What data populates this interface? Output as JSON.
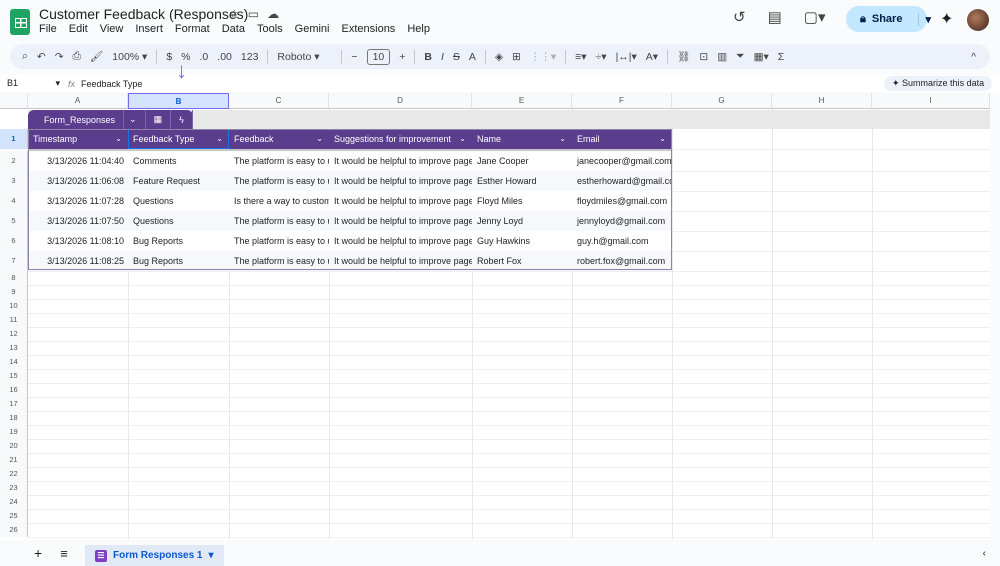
{
  "app": {
    "title": "Customer Feedback (Responses)",
    "menu": [
      "File",
      "Edit",
      "View",
      "Insert",
      "Format",
      "Data",
      "Tools",
      "Gemini",
      "Extensions",
      "Help"
    ],
    "share_label": "Share"
  },
  "toolbar": {
    "zoom": "100%",
    "currency": "$",
    "percent": "%",
    "dec_decrease": ".0",
    "dec_increase": ".00",
    "format": "123",
    "font": "Roboto",
    "font_size": "10",
    "bold": "B",
    "italic": "I"
  },
  "formula_bar": {
    "cell_ref": "B1",
    "fx": "fx",
    "value": "Feedback Type"
  },
  "summarize_label": "Summarize this data",
  "columns": [
    "A",
    "B",
    "C",
    "D",
    "E",
    "F",
    "G",
    "H",
    "I"
  ],
  "rows": [
    "1",
    "2",
    "3",
    "4",
    "5",
    "6",
    "7",
    "8",
    "9",
    "10",
    "11",
    "12",
    "13",
    "14",
    "15",
    "16",
    "17",
    "18",
    "19",
    "20",
    "21",
    "22",
    "23",
    "24",
    "25",
    "26"
  ],
  "table": {
    "name": "Form_Responses",
    "headers": [
      "Timestamp",
      "Feedback Type",
      "Feedback",
      "Suggestions for improvement",
      "Name",
      "Email"
    ],
    "data": [
      [
        "3/13/2026 11:04:40",
        "Comments",
        "The platform is easy to use",
        "It would be helpful to improve page",
        "Jane Cooper",
        "janecooper@gmail.com"
      ],
      [
        "3/13/2026 11:06:08",
        "Feature Request",
        "The platform is easy to use",
        "It would be helpful to improve page",
        "Esther Howard",
        "estherhoward@gmail.com"
      ],
      [
        "3/13/2026 11:07:28",
        "Questions",
        "Is there a way to customize",
        "It would be helpful to improve page",
        "Floyd Miles",
        "floydmiles@gmail.com"
      ],
      [
        "3/13/2026 11:07:50",
        "Questions",
        "The platform is easy to use",
        "It would be helpful to improve page",
        "Jenny Loyd",
        "jennyloyd@gmail.com"
      ],
      [
        "3/13/2026 11:08:10",
        "Bug Reports",
        "The platform is easy to use",
        "It would be helpful to improve page",
        "Guy Hawkins",
        "guy.h@gmail.com"
      ],
      [
        "3/13/2026 11:08:25",
        "Bug Reports",
        "The platform is easy to use",
        "It would be helpful to improve page",
        "Robert Fox",
        "robert.fox@gmail.com"
      ]
    ]
  },
  "sheet_tab": "Form Responses 1",
  "colors": {
    "table_header": "#5b3d8e",
    "accent": "#7b68ee",
    "share": "#c2e7ff"
  }
}
